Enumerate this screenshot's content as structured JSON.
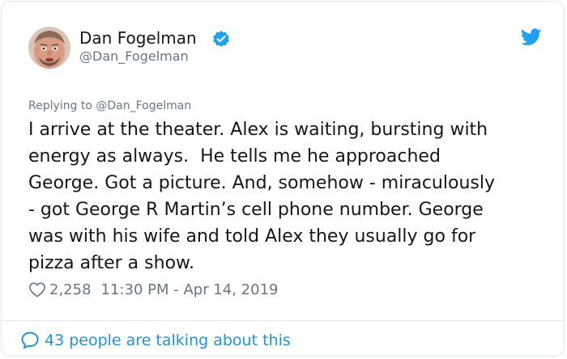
{
  "tweet": {
    "author_name": "Dan Fogelman",
    "author_handle": "@Dan_Fogelman",
    "replying_to": "Replying to @Dan_Fogelman",
    "text": "I arrive at the theater. Alex is waiting, bursting with\nenergy as always.  He tells me he approached\nGeorge. Got a picture. And, somehow - miraculously\n- got George R Martin’s cell phone number. George\nwas with his wife and told Alex they usually go for\npizza after a show.",
    "likes": "2,258",
    "timestamp": "11:30 PM - Apr 14, 2019",
    "talking_text": "43 people are talking about this"
  },
  "icons": {
    "verified": "verified-badge-icon",
    "brand": "twitter-bird-icon",
    "like": "heart-icon",
    "conversation": "speech-bubble-icon"
  },
  "colors": {
    "twitter_blue": "#1da1f2",
    "link_blue": "#1b95e0",
    "secondary_text": "#657786",
    "primary_text": "#14171a",
    "border": "#e1e8ed"
  }
}
